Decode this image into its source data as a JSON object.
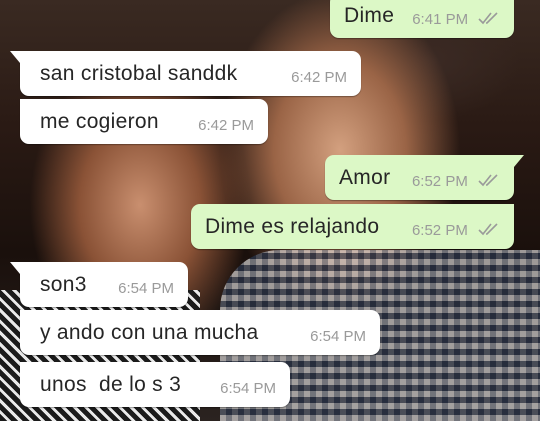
{
  "colors": {
    "incoming_bubble": "#ffffff",
    "outgoing_bubble": "#dcf8c6",
    "timestamp": "#9a9a9a",
    "read_check": "#9a9a9a"
  },
  "messages": [
    {
      "direction": "outgoing",
      "text": "Dime",
      "time": "6:41 PM",
      "status_icon": "double-check-icon"
    },
    {
      "direction": "incoming",
      "text": "san cristobal sanddk",
      "time": "6:42 PM"
    },
    {
      "direction": "incoming",
      "text": "me cogieron",
      "time": "6:42 PM"
    },
    {
      "direction": "outgoing",
      "text": "Amor",
      "time": "6:52 PM",
      "status_icon": "double-check-icon"
    },
    {
      "direction": "outgoing",
      "text": "Dime es relajando",
      "time": "6:52 PM",
      "status_icon": "double-check-icon"
    },
    {
      "direction": "incoming",
      "text": "son3",
      "time": "6:54 PM"
    },
    {
      "direction": "incoming",
      "text": "y ando con una mucha",
      "time": "6:54 PM"
    },
    {
      "direction": "incoming",
      "text": "unos  de lo s 3",
      "time": "6:54 PM"
    }
  ]
}
